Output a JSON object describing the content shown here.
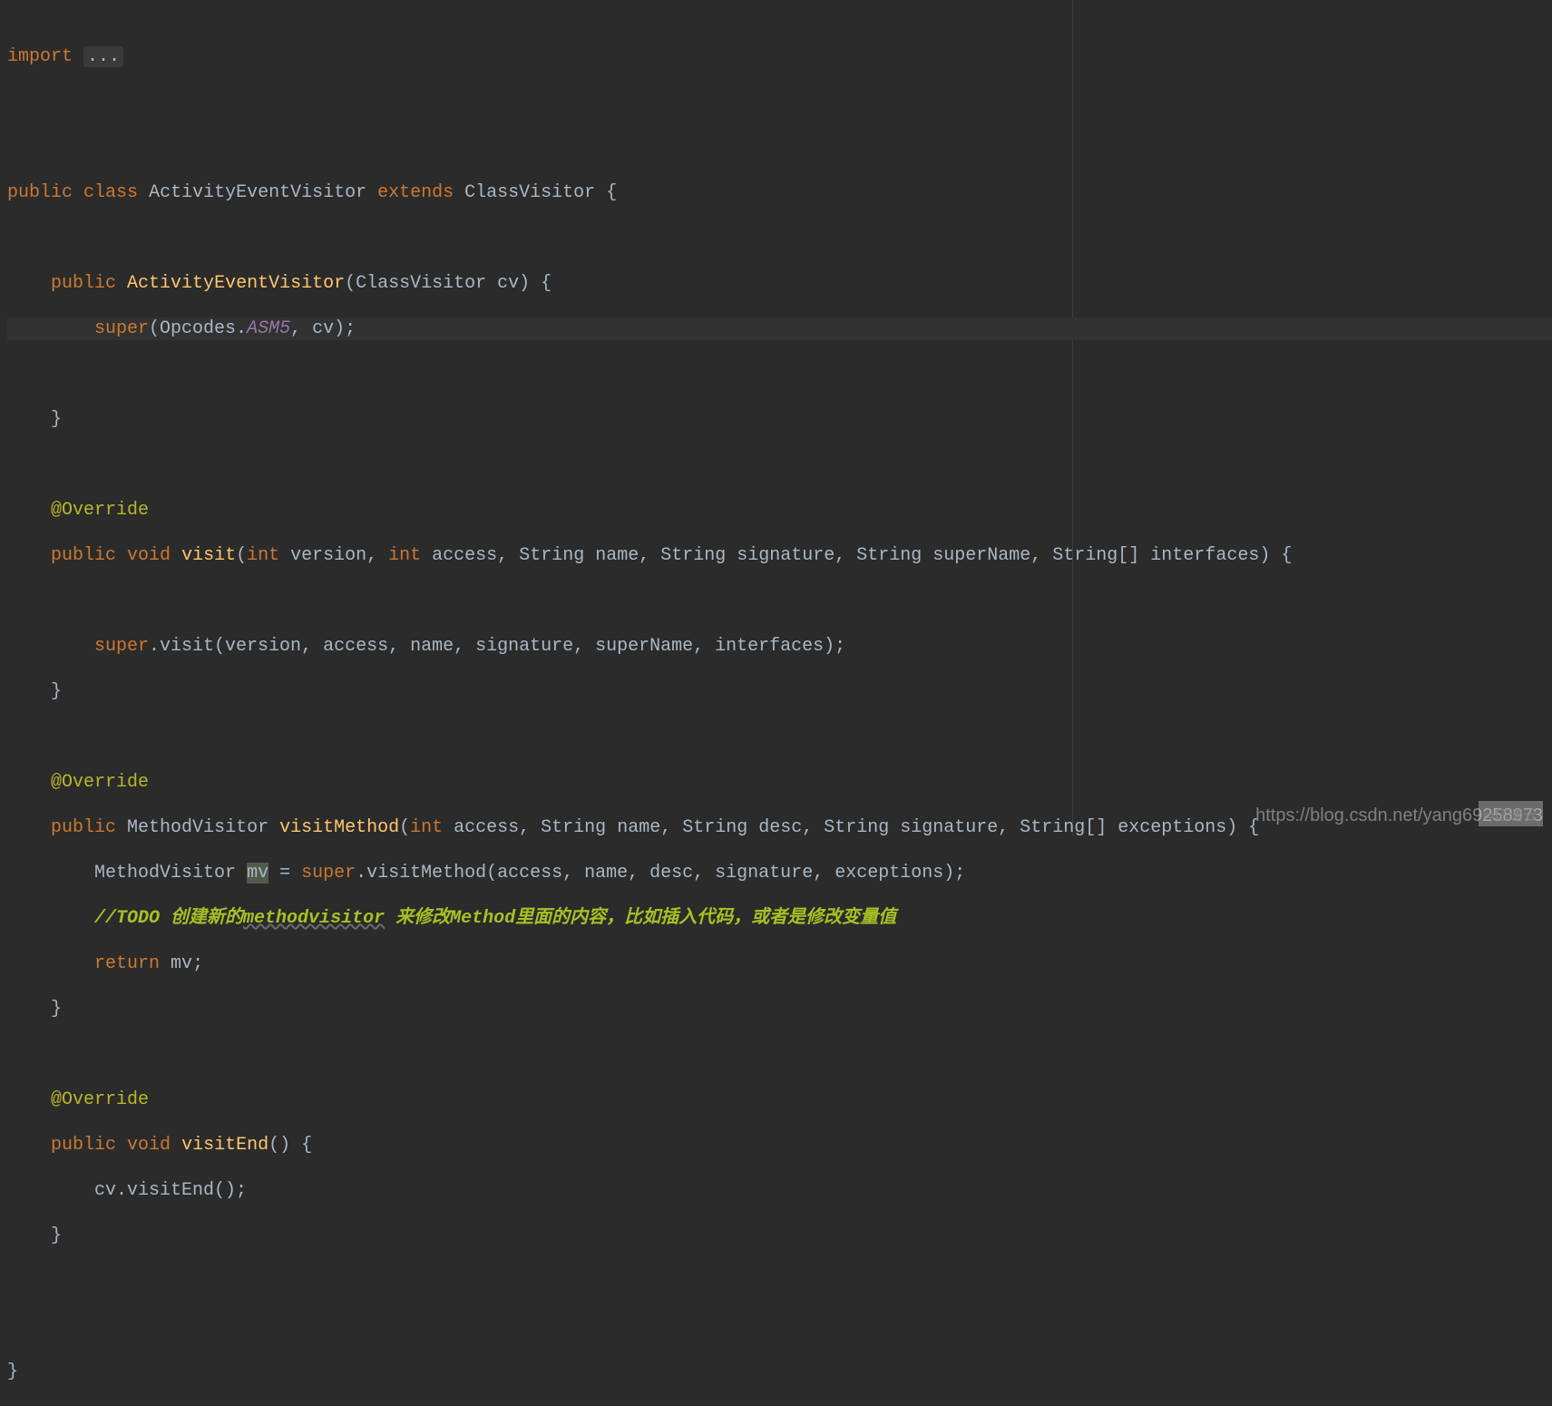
{
  "code": {
    "import_keyword": "import",
    "import_folded": "...",
    "class_decl": {
      "public": "public",
      "class": "class",
      "name": "ActivityEventVisitor",
      "extends": "extends",
      "superclass": "ClassVisitor",
      "brace": "{"
    },
    "constructor": {
      "public": "public",
      "name": "ActivityEventVisitor",
      "param_type": "ClassVisitor",
      "param_name": "cv",
      "open": "(",
      "close": ") {",
      "super": "super",
      "opcodes": "(Opcodes.",
      "asm5": "ASM5",
      "end": ", cv);",
      "close_brace": "}"
    },
    "visit": {
      "override": "@Override",
      "public": "public",
      "void": "void",
      "name": "visit",
      "sig": "(int version, int access, String name, String signature, String superName, String[] interfaces) {",
      "super": "super",
      "call": ".visit(version, access, name, signature, superName, interfaces);",
      "close": "}"
    },
    "visitMethod": {
      "override": "@Override",
      "public": "public",
      "return_type": "MethodVisitor",
      "name": "visitMethod",
      "sig": "(int access, String name, String desc, String signature, String[] exceptions) {",
      "local_type": "MethodVisitor",
      "local_var": "mv",
      "equals": " = ",
      "super": "super",
      "call": ".visitMethod(access, name, desc, signature, exceptions);",
      "comment_prefix": "//",
      "comment_todo": "TODO 创建新的",
      "comment_underlined": "methodvisitor",
      "comment_rest": " 来修改Method里面的内容，比如插入代码，或者是修改变量值",
      "return": "return",
      "return_var": "mv",
      "semi": ";",
      "close": "}"
    },
    "visitEnd": {
      "override": "@Override",
      "public": "public",
      "void": "void",
      "name": "visitEnd",
      "sig": "() {",
      "body": "cv.visitEnd();",
      "close": "}"
    },
    "class_close": "}"
  },
  "watermark": {
    "url": "https://blog.csdn.net/yang69258973",
    "logo": "∞亿速云"
  }
}
